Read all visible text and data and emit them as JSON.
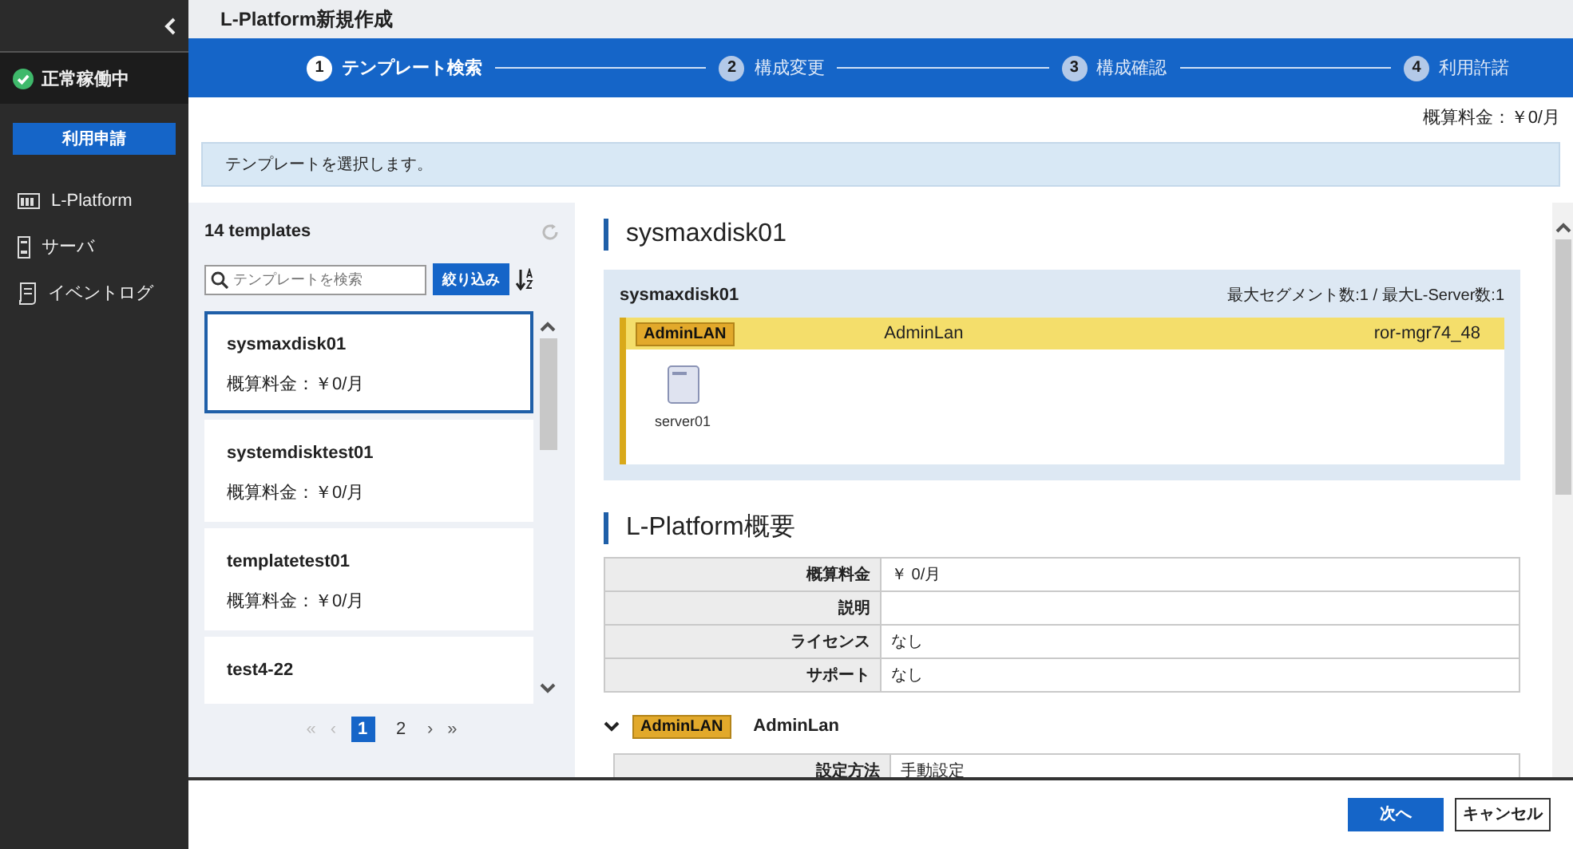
{
  "sidebar": {
    "status": "正常稼働中",
    "apply_button": "利用申請",
    "items": [
      {
        "label": "L-Platform"
      },
      {
        "label": "サーバ"
      },
      {
        "label": "イベントログ"
      }
    ]
  },
  "page_title": "L-Platform新規作成",
  "steps": [
    {
      "number": "1",
      "label": "テンプレート検索",
      "selected": true
    },
    {
      "number": "2",
      "label": "構成変更",
      "selected": false
    },
    {
      "number": "3",
      "label": "構成確認",
      "selected": false
    },
    {
      "number": "4",
      "label": "利用許諾",
      "selected": false
    }
  ],
  "estimated_fee": "概算料金：￥0/月",
  "info_message": "テンプレートを選択します。",
  "template_list": {
    "count": "14 templates",
    "search": {
      "placeholder": "テンプレートを検索"
    },
    "filter_button": "絞り込み",
    "items": [
      {
        "name": "sysmaxdisk01",
        "fee": "概算料金：￥0/月",
        "selected": true
      },
      {
        "name": "systemdisktest01",
        "fee": "概算料金：￥0/月",
        "selected": false
      },
      {
        "name": "templatetest01",
        "fee": "概算料金：￥0/月",
        "selected": false
      },
      {
        "name": "test4-22",
        "selected": false
      }
    ],
    "pagination": {
      "first": {
        "label": "«",
        "disabled": true
      },
      "prev": {
        "label": "‹",
        "disabled": true
      },
      "pages": [
        {
          "label": "1",
          "selected": true
        },
        {
          "label": "2",
          "selected": false
        }
      ],
      "next": {
        "label": "›",
        "disabled": false
      },
      "last": {
        "label": "»",
        "disabled": false
      }
    }
  },
  "detail": {
    "title": "sysmaxdisk01",
    "diagram": {
      "name": "sysmaxdisk01",
      "limits": "最大セグメント数:1 / 最大L-Server数:1",
      "segments": [
        {
          "tag": "AdminLAN",
          "name": "AdminLan",
          "resource": "ror-mgr74_48",
          "servers": [
            "server01"
          ]
        }
      ]
    },
    "overview_title": "L-Platform概要",
    "overview": [
      {
        "label": "概算料金",
        "value": "￥ 0/月"
      },
      {
        "label": "説明"
      },
      {
        "label": "ライセンス",
        "value": "なし"
      },
      {
        "label": "サポート",
        "value": "なし"
      }
    ],
    "segment_sections": [
      {
        "tag": "AdminLAN",
        "name": "AdminLan",
        "expanded": true,
        "rows": [
          {
            "label": "設定方法",
            "value": "手動設定"
          }
        ]
      }
    ]
  },
  "buttons": [
    {
      "label": "次へ",
      "kind": "primary"
    },
    {
      "label": "キャンセル",
      "kind": "secondary"
    }
  ]
}
